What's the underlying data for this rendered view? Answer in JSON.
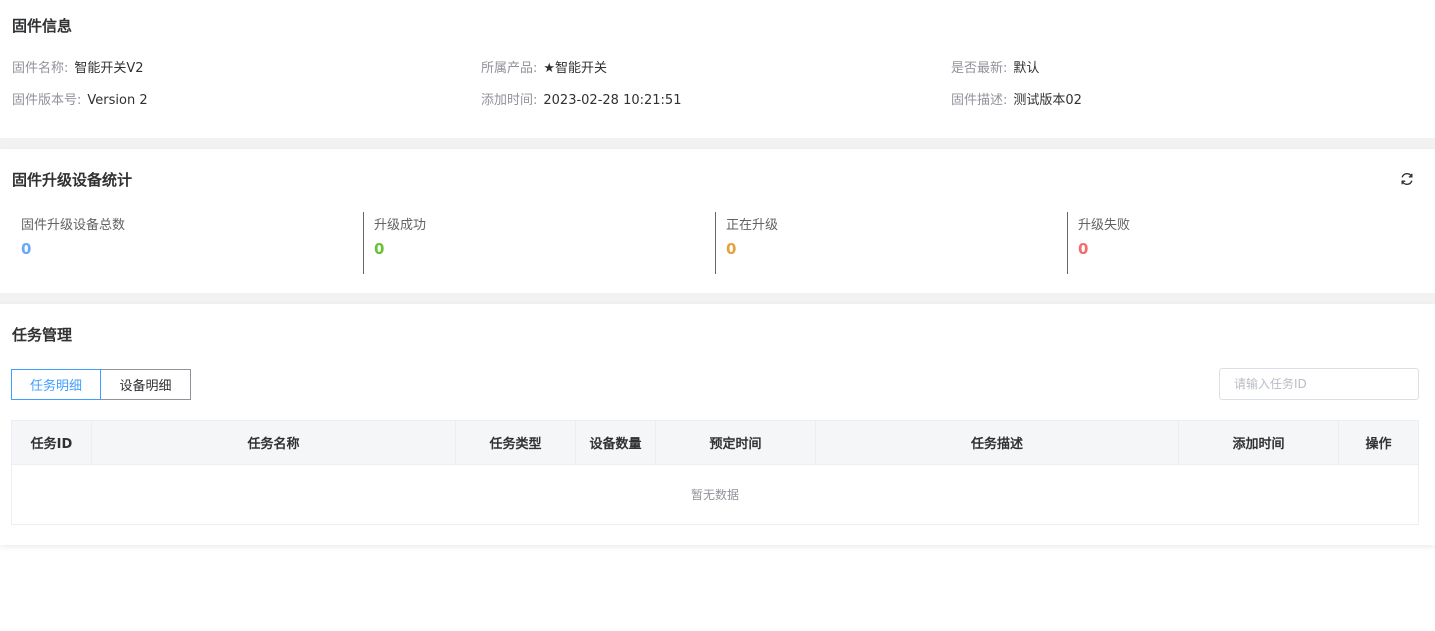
{
  "firmware_info": {
    "title": "固件信息",
    "name_label": "固件名称:",
    "name_value": "智能开关V2",
    "product_label": "所属产品:",
    "product_value": "★智能开关",
    "latest_label": "是否最新:",
    "latest_value": "默认",
    "version_label": "固件版本号:",
    "version_value": "Version 2",
    "added_label": "添加时间:",
    "added_value": "2023-02-28 10:21:51",
    "desc_label": "固件描述:",
    "desc_value": "测试版本02"
  },
  "stats": {
    "title": "固件升级设备统计",
    "refresh_icon": "refresh-icon",
    "items": [
      {
        "label": "固件升级设备总数",
        "value": "0",
        "color": "#409eff"
      },
      {
        "label": "升级成功",
        "value": "0",
        "color": "#67c23a"
      },
      {
        "label": "正在升级",
        "value": "0",
        "color": "#e6a23c"
      },
      {
        "label": "升级失败",
        "value": "0",
        "color": "#f56c6c"
      }
    ]
  },
  "tasks": {
    "title": "任务管理",
    "tabs": [
      {
        "label": "任务明细",
        "active": true
      },
      {
        "label": "设备明细",
        "active": false
      }
    ],
    "search": {
      "placeholder": "请输入任务ID",
      "value": ""
    },
    "columns": [
      "任务ID",
      "任务名称",
      "任务类型",
      "设备数量",
      "预定时间",
      "任务描述",
      "添加时间",
      "操作"
    ],
    "empty_text": "暂无数据"
  }
}
